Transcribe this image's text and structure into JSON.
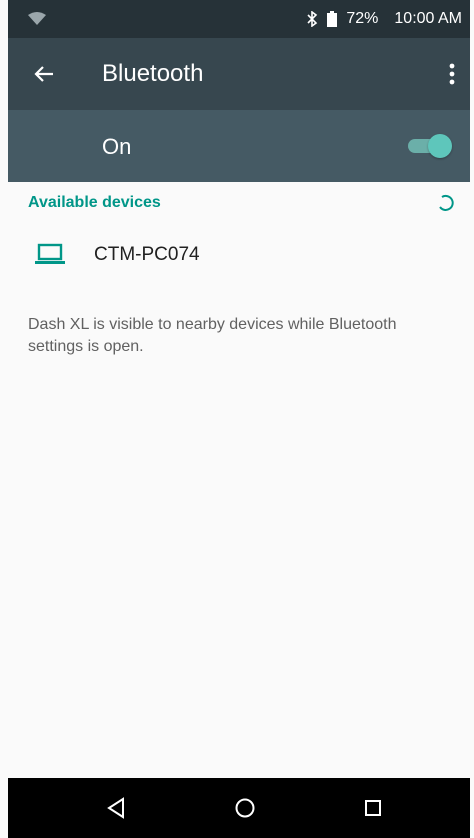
{
  "status_bar": {
    "battery_percent": "72%",
    "time": "10:00 AM",
    "icons": [
      "wifi-icon",
      "bluetooth-icon",
      "battery-icon"
    ]
  },
  "app_bar": {
    "title": "Bluetooth",
    "icons": [
      "back-arrow-icon",
      "more-vert-icon"
    ]
  },
  "master_switch": {
    "label": "On",
    "checked": true
  },
  "available_devices": {
    "header": "Available devices",
    "devices": [
      {
        "name": "CTM-PC074",
        "icon": "laptop-icon"
      }
    ]
  },
  "info": {
    "text": "Dash XL is visible to nearby devices while Bluetooth settings is open."
  },
  "nav_bar": {
    "icons": [
      "nav-back-icon",
      "nav-home-icon",
      "nav-recents-icon"
    ]
  },
  "colors": {
    "status_bar": "#263238",
    "app_bar": "#37474f",
    "switch_bar": "#455a64",
    "accent": "#009688",
    "toggle": "#5ec6bb",
    "background": "#fafafa"
  }
}
